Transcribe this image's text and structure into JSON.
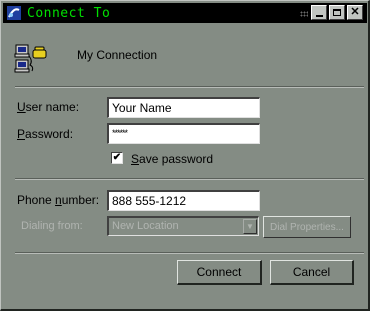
{
  "window": {
    "title": "Connect To",
    "title_color": "#00e000",
    "icon": "dial-up-networking-icon",
    "controls": {
      "minimize": "minimize-icon",
      "maximize": "maximize-icon",
      "close_label": "✕"
    }
  },
  "connection": {
    "icon": "dial-up-computers-icon",
    "name": "My Connection"
  },
  "credentials": {
    "username_label_underlined": "U",
    "username_label_rest": "ser name:",
    "username_value": "Your Name",
    "password_label_underlined": "P",
    "password_label_rest": "assword:",
    "password_value": "******",
    "save_password_checked": true,
    "save_password_check": "✔",
    "save_password_underlined": "S",
    "save_password_rest": "ave password"
  },
  "phone": {
    "label_prefix": "Phone ",
    "label_underlined": "n",
    "label_suffix": "umber:",
    "value": "888 555-1212",
    "dialing_from_label": "Dialing from:",
    "dialing_from_value": "New Location",
    "dial_properties_label": "Dial Properties..."
  },
  "buttons": {
    "connect": "Connect",
    "cancel": "Cancel"
  },
  "colors": {
    "dialog_bg": "#848c84",
    "disabled_text": "#b0b4b0"
  }
}
